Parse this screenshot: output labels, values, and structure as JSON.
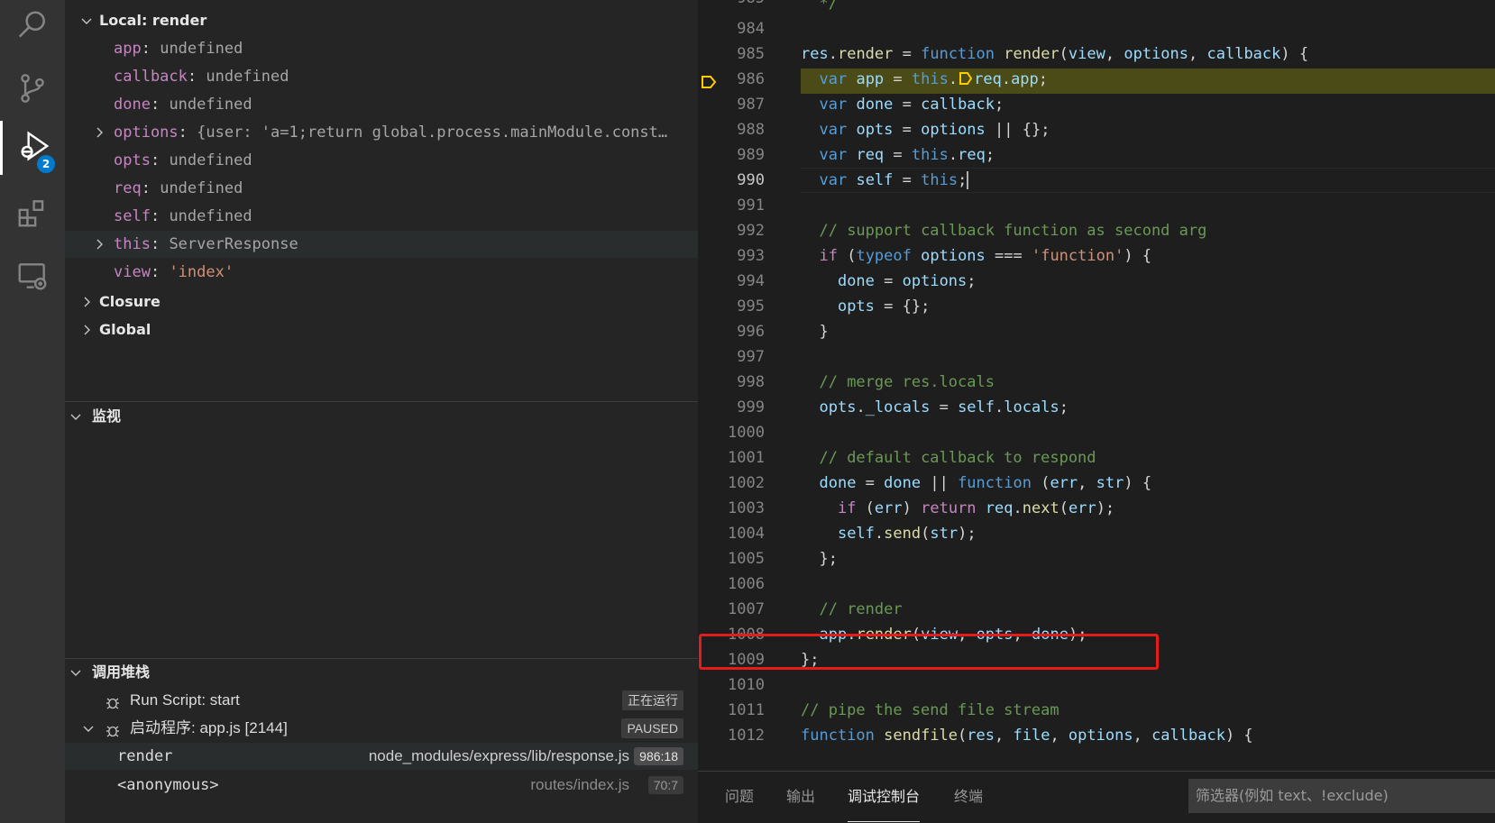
{
  "activity_bar": {
    "items": [
      {
        "icon": "search-icon"
      },
      {
        "icon": "source-control-icon"
      },
      {
        "icon": "run-debug-icon",
        "badge": "2",
        "active": true
      },
      {
        "icon": "extensions-icon"
      },
      {
        "icon": "remote-explorer-icon"
      }
    ]
  },
  "variables": {
    "local_scope": "Local: render",
    "items": [
      {
        "name": "app",
        "value": "undefined",
        "kind": "undefined",
        "expandable": false
      },
      {
        "name": "callback",
        "value": "undefined",
        "kind": "undefined",
        "expandable": false
      },
      {
        "name": "done",
        "value": "undefined",
        "kind": "undefined",
        "expandable": false
      },
      {
        "name": "options",
        "value": "{user: 'a=1;return global.process.mainModule.const…",
        "kind": "object",
        "expandable": true
      },
      {
        "name": "opts",
        "value": "undefined",
        "kind": "undefined",
        "expandable": false
      },
      {
        "name": "req",
        "value": "undefined",
        "kind": "undefined",
        "expandable": false
      },
      {
        "name": "self",
        "value": "undefined",
        "kind": "undefined",
        "expandable": false
      },
      {
        "name": "this",
        "value": "ServerResponse",
        "kind": "object",
        "expandable": true
      },
      {
        "name": "view",
        "value": "'index'",
        "kind": "string",
        "expandable": false
      }
    ],
    "other_scopes": [
      "Closure",
      "Global"
    ]
  },
  "watch": {
    "title": "监视"
  },
  "call_stack": {
    "title": "调用堆栈",
    "sessions": [
      {
        "name": "Run Script: start",
        "state": "正在运行"
      },
      {
        "name": "启动程序: app.js [2144]",
        "state": "PAUSED"
      }
    ],
    "frames": [
      {
        "name": "render",
        "file": "node_modules/express/lib/response.js",
        "pos": "986:18"
      },
      {
        "name": "<anonymous>",
        "file": "routes/index.js",
        "pos": "70:7"
      }
    ]
  },
  "editor": {
    "line_numbers": [
      "985",
      "984",
      "985",
      "986",
      "987",
      "988",
      "989",
      "990",
      "991",
      "992",
      "993",
      "994",
      "995",
      "996",
      "997",
      "998",
      "999",
      "1000",
      "1001",
      "1002",
      "1003",
      "1004",
      "1005",
      "1006",
      "1007",
      "1008",
      "1009",
      "1010",
      "1011",
      "1012"
    ],
    "current_line": "990",
    "paused_line": "986",
    "boxed_line": "1008"
  },
  "panel": {
    "tabs": [
      "问题",
      "输出",
      "调试控制台",
      "终端"
    ],
    "active_tab": "调试控制台",
    "filter_placeholder": "筛选器(例如 text、!exclude)"
  },
  "colors": {
    "breakpoint_arrow": "#ffcc00",
    "paused_line_bg": "#4b4b18",
    "highlight_box": "#e51c1c",
    "badge": "#007acc"
  }
}
